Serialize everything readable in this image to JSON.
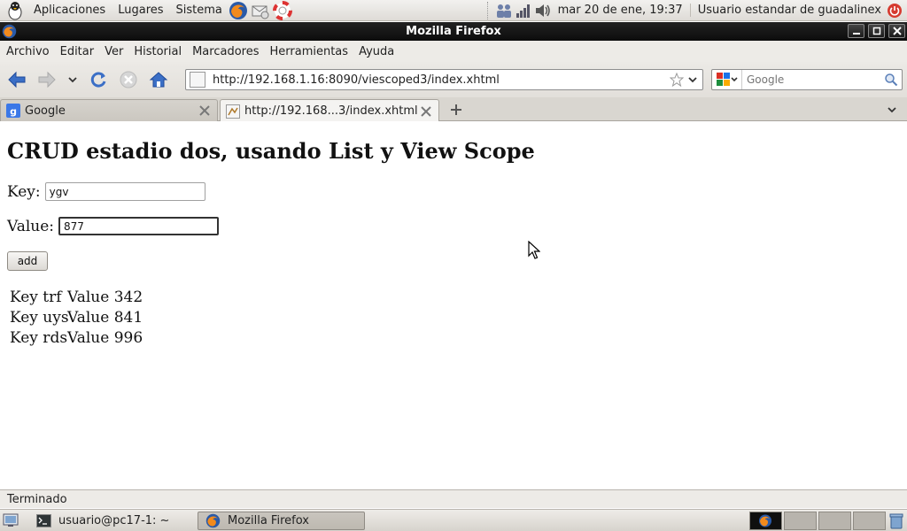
{
  "top_panel": {
    "menus": [
      "Aplicaciones",
      "Lugares",
      "Sistema"
    ],
    "clock": "mar 20 de ene, 19:37",
    "user": "Usuario estandar de guadalinex"
  },
  "window": {
    "title": "Mozilla Firefox"
  },
  "menubar": {
    "items": [
      "Archivo",
      "Editar",
      "Ver",
      "Historial",
      "Marcadores",
      "Herramientas",
      "Ayuda"
    ]
  },
  "navbar": {
    "url": "http://192.168.1.16:8090/viescoped3/index.xhtml",
    "search_placeholder": "Google"
  },
  "tabs": [
    {
      "label": "Google",
      "active": false
    },
    {
      "label": "http://192.168...3/index.xhtml",
      "active": true
    }
  ],
  "page": {
    "heading": "CRUD estadio dos, usando List y View Scope",
    "key_label": "Key:",
    "key_value": "ygv",
    "value_label": "Value:",
    "value_value": "877",
    "add_button": "add",
    "results": [
      {
        "key": "Key trf",
        "value": "Value 342"
      },
      {
        "key": "Key uys",
        "value": "Value 841"
      },
      {
        "key": "Key rds",
        "value": "Value 996"
      }
    ]
  },
  "statusbar": {
    "text": "Terminado"
  },
  "bottom_panel": {
    "tasks": [
      {
        "label": "usuario@pc17-1: ~",
        "active": false
      },
      {
        "label": "Mozilla Firefox",
        "active": true
      }
    ]
  },
  "colors": {
    "title_bar": "#111111",
    "panel": "#e6e3de",
    "link_blue": "#1f4a9a"
  }
}
